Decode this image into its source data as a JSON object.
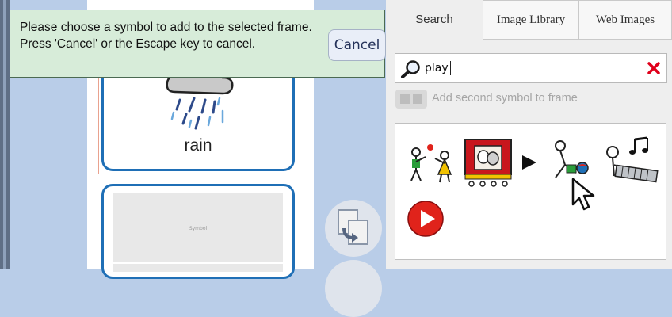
{
  "notice": {
    "message": "Please choose a symbol to add to the selected frame. Press 'Cancel' or the Escape key to cancel.",
    "cancel_label": "Cancel"
  },
  "cards": {
    "rain_label": "rain",
    "empty_placeholder": "Symbol"
  },
  "tabs": [
    {
      "label": "Search",
      "active": true
    },
    {
      "label": "Image Library",
      "active": false
    },
    {
      "label": "Web Images",
      "active": false
    }
  ],
  "search": {
    "value": "play",
    "icon": "search-icon",
    "clear_icon": "close-icon",
    "clear_color": "#e0001b"
  },
  "second_symbol": {
    "label": "Add second symbol to frame",
    "enabled": false
  },
  "results": [
    {
      "name": "children-playing-ball-symbol"
    },
    {
      "name": "theatre-play-symbol"
    },
    {
      "name": "play-triangle-symbol"
    },
    {
      "name": "child-playing-with-ball-symbol"
    },
    {
      "name": "playing-keyboard-music-symbol"
    },
    {
      "name": "play-button-red-circle-symbol"
    }
  ],
  "colors": {
    "notice_bg": "#d7ecd9",
    "card_border": "#1f6fb6",
    "play_red": "#e0231b"
  }
}
